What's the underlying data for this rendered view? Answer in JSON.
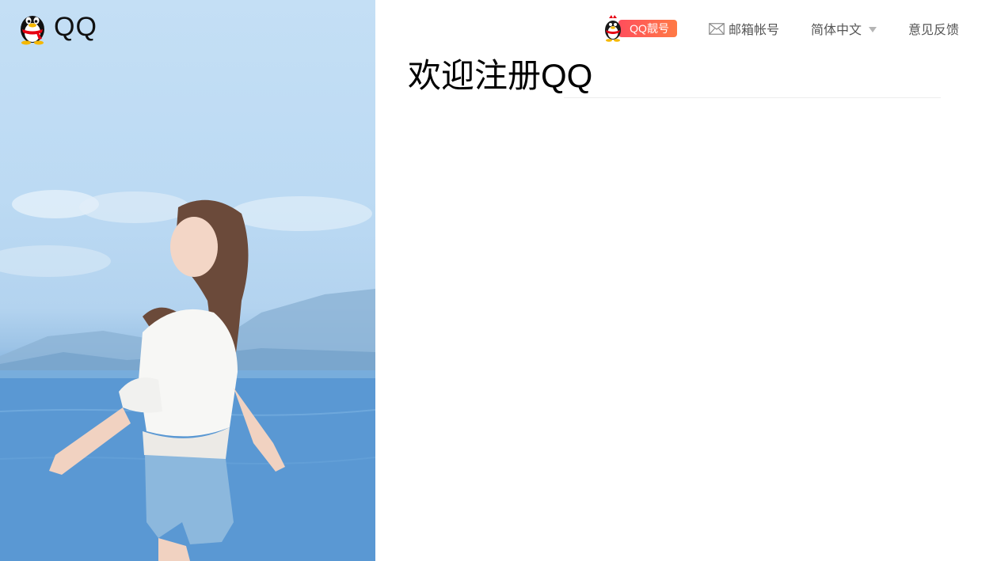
{
  "brand": {
    "name": "QQ",
    "logo_icon": "qq-penguin-icon"
  },
  "nav": {
    "vip": {
      "label": "QQ靓号",
      "icon": "qq-penguin-vip-icon",
      "colors": [
        "#ff4e5c",
        "#ff7a45"
      ]
    },
    "mail": {
      "label": "邮箱帐号",
      "icon": "mail-icon"
    },
    "language": {
      "label": "简体中文",
      "icon": "caret-down-icon"
    },
    "feedback": {
      "label": "意见反馈"
    }
  },
  "main": {
    "title": "欢迎注册QQ"
  },
  "colors": {
    "accent": "#ff5a4f",
    "text": "#555555",
    "title": "#000000",
    "hero_sky": "#c4dff5",
    "hero_sea": "#4f8fd0"
  }
}
